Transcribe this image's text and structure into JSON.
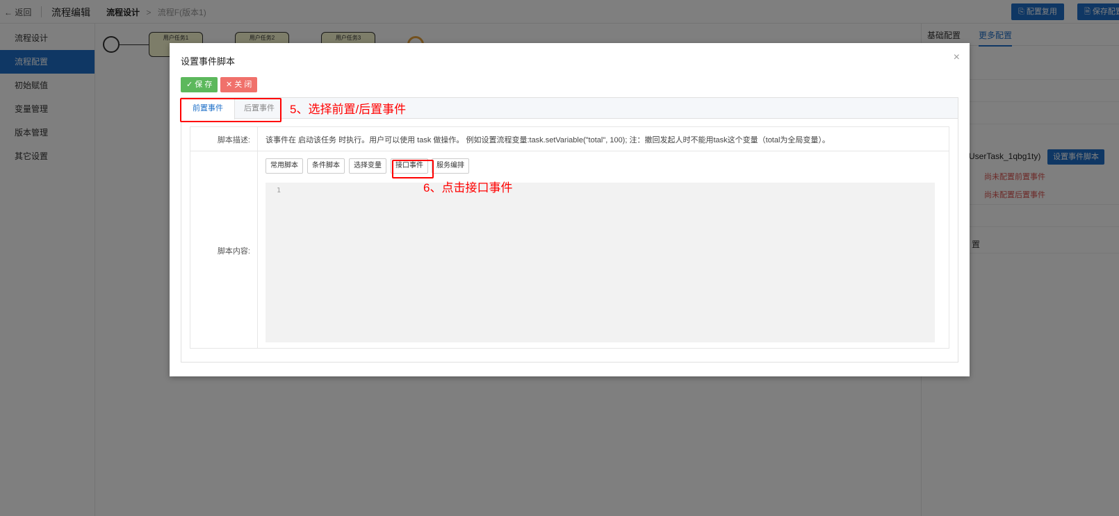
{
  "topbar": {
    "back_label": "← 返回",
    "app_title": "流程编辑",
    "breadcrumb_current": "流程设计",
    "breadcrumb_sep": ">",
    "breadcrumb_item": "流程F(版本1)",
    "btn_reuse": "配置复用",
    "btn_save_config": "保存配置"
  },
  "sidebar": {
    "items": [
      {
        "label": "流程设计",
        "active": false
      },
      {
        "label": "流程配置",
        "active": true
      },
      {
        "label": "初始赋值",
        "active": false
      },
      {
        "label": "变量管理",
        "active": false
      },
      {
        "label": "版本管理",
        "active": false
      },
      {
        "label": "其它设置",
        "active": false
      }
    ]
  },
  "diagram": {
    "tasks": [
      "用户任务1",
      "用户任务2",
      "用户任务3"
    ]
  },
  "rightpanel": {
    "tabs": [
      "基础配置",
      "更多配置"
    ],
    "active_tab": "更多配置",
    "row_labels": [
      "置"
    ],
    "task_label": "(UserTask_1qbg1ty)",
    "set_event_btn": "设置事件脚本",
    "warn_pre": "尚未配置前置事件",
    "warn_post": "尚未配置后置事件"
  },
  "modal": {
    "title": "设置事件脚本",
    "close_glyph": "×",
    "save_btn": "✓ 保 存",
    "close_btn": "✕ 关 闭",
    "tabs": [
      "前置事件",
      "后置事件"
    ],
    "active_tab": "前置事件",
    "desc_label": "脚本描述:",
    "desc_text": "该事件在 启动该任务 时执行。用户可以使用 task 做操作。 例如设置流程变量:task.setVariable(\"total\", 100); 注：撤回发起人时不能用task这个变量（total为全局变量）。",
    "content_label": "脚本内容:",
    "script_buttons": [
      "常用脚本",
      "条件脚本",
      "选择变量",
      "接口事件",
      "服务编排"
    ],
    "editor_line": "1"
  },
  "annotations": {
    "step5": "5、选择前置/后置事件",
    "step6": "6、点击接口事件"
  },
  "colors": {
    "primary": "#1e6fc8",
    "save_green": "#5cb85c",
    "close_red": "#f0716b",
    "annotation_red": "#ff0000",
    "warn_red": "#d9534f"
  }
}
